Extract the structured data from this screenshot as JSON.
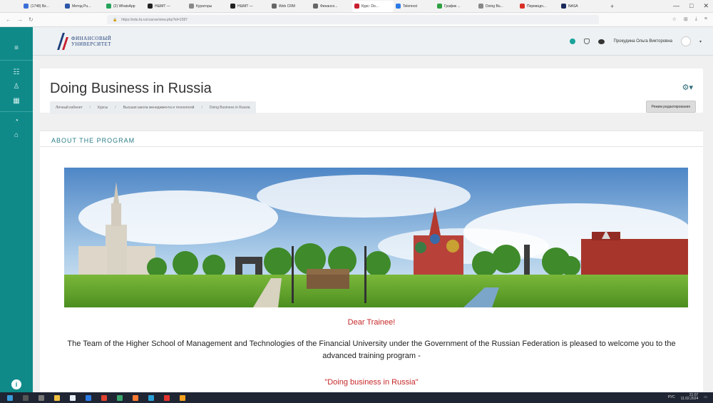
{
  "browser": {
    "tabs": [
      {
        "label": "(1748) Bz...",
        "color": "#3a6fd8"
      },
      {
        "label": "Метод Pu...",
        "color": "#2c56a8"
      },
      {
        "label": "(2) WhatsApp",
        "color": "#25a35a"
      },
      {
        "label": "НШМТ —",
        "color": "#222222"
      },
      {
        "label": "Кураторы",
        "color": "#888888"
      },
      {
        "label": "НШМТ —",
        "color": "#222222"
      },
      {
        "label": "Web CRM",
        "color": "#666666"
      },
      {
        "label": "Финансо...",
        "color": "#666666"
      },
      {
        "label": "Курс: Do...",
        "color": "#c8202f",
        "active": true
      },
      {
        "label": "Telemost",
        "color": "#2c7be5"
      },
      {
        "label": "График ...",
        "color": "#2ea043"
      },
      {
        "label": "Doing Bu...",
        "color": "#888888"
      },
      {
        "label": "Переводч...",
        "color": "#d93025"
      },
      {
        "label": "NASA",
        "color": "#1b2a5c"
      }
    ],
    "url": "https://edu.fa.ru/course/view.php?id=2287",
    "window_controls": [
      "—",
      "□",
      "✕"
    ]
  },
  "header": {
    "logo_line1": "ФИНАНСОВЫЙ",
    "logo_line2": "УНИВЕРСИТЕТ",
    "user_name": "Прокудина Ольга Викторовна"
  },
  "course": {
    "title": "Doing Business in Russia",
    "breadcrumb": [
      "Личный кабинет",
      "Курсы",
      "Высшая школа менеджмента и технологий",
      "Doing Business in Russia"
    ],
    "edit_mode_label": "Режим редактирования"
  },
  "section": {
    "title": "ABOUT THE PROGRAM",
    "greeting": "Dear Trainee!",
    "welcome_text": "The Team of the Higher School of Management and Technologies of the Financial University under the Government of the Russian Federation is pleased to welcome you to the advanced training program -",
    "program_name": "\"Doing business in Russia\""
  },
  "taskbar": {
    "tray_text": "РУС",
    "time": "21:07",
    "date": "11.02.2024"
  },
  "colors": {
    "sidebar": "#0f8a89",
    "accent_red": "#c62828",
    "section_teal": "#2b7e86"
  }
}
